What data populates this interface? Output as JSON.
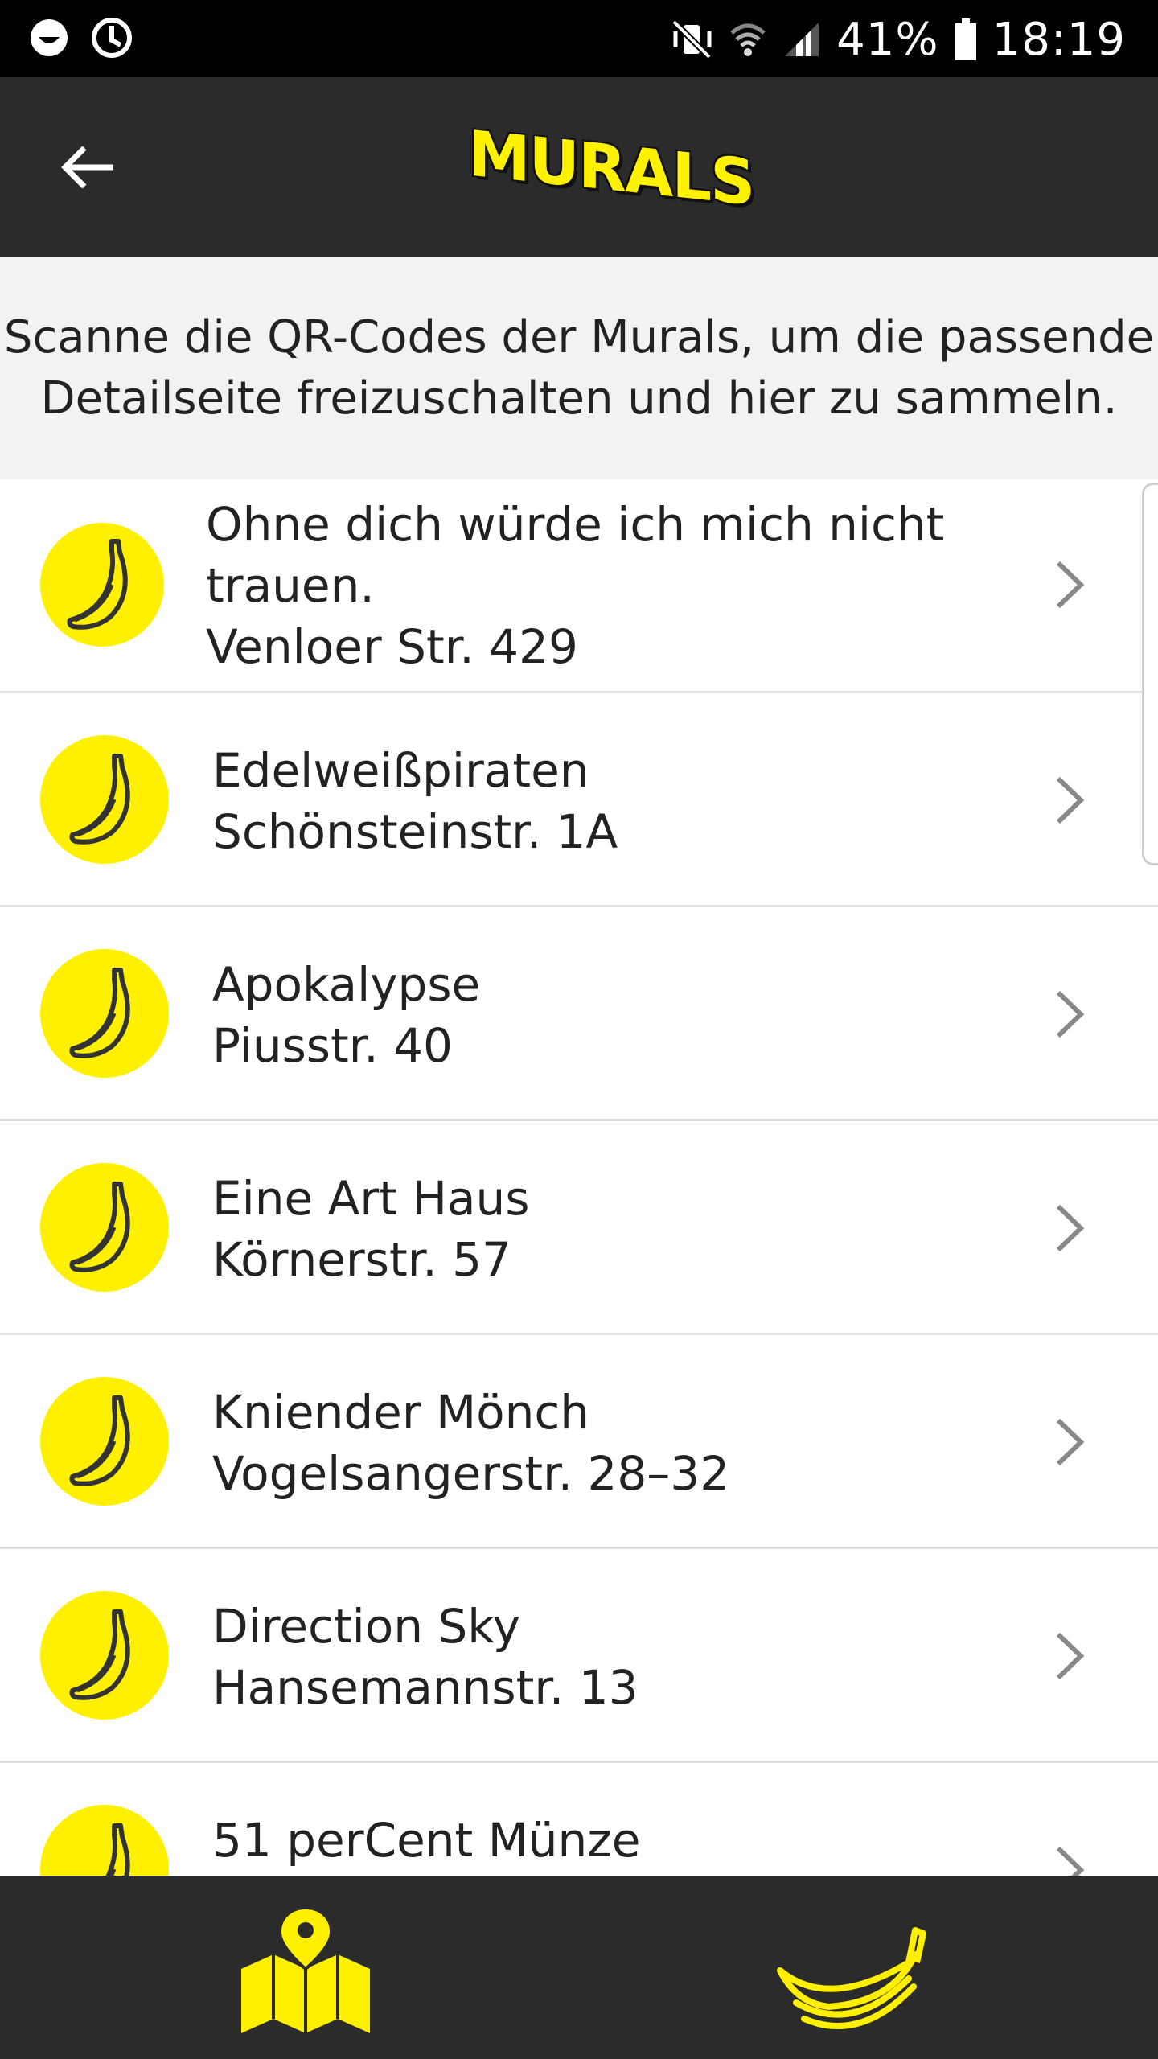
{
  "status_bar": {
    "battery": "41%",
    "time": "18:19",
    "icons": [
      "smiley-icon",
      "sync-icon",
      "mute-vibrate-icon",
      "wifi-icon",
      "signal-icon",
      "battery-icon"
    ]
  },
  "app_bar": {
    "logo_text": "MURALS",
    "back_icon": "arrow-left-icon"
  },
  "info": {
    "text": "Scanne die QR-Codes der Murals, um die passende\nDetailseite freizuschalten und hier zu sammeln."
  },
  "murals": [
    {
      "title": "Ohne dich würde ich mich nicht\ntrauen.",
      "address": "Venloer Str. 429"
    },
    {
      "title": "Edelweißpiraten",
      "address": "Schönsteinstr. 1A"
    },
    {
      "title": "Apokalypse",
      "address": "Piusstr. 40"
    },
    {
      "title": "Eine Art Haus",
      "address": "Körnerstr. 57"
    },
    {
      "title": "Kniender Mönch",
      "address": "Vogelsangerstr. 28–32"
    },
    {
      "title": "Direction Sky",
      "address": "Hansemannstr. 13"
    },
    {
      "title": "51 perCent Münze",
      "address": ""
    }
  ],
  "bottom_nav": {
    "items": [
      {
        "icon": "map-pin-icon",
        "active": true
      },
      {
        "icon": "bananas-icon",
        "active": true
      }
    ]
  },
  "colors": {
    "accent": "#fff000",
    "bar": "#2b2b2b",
    "banner": "#f2f2f2"
  }
}
